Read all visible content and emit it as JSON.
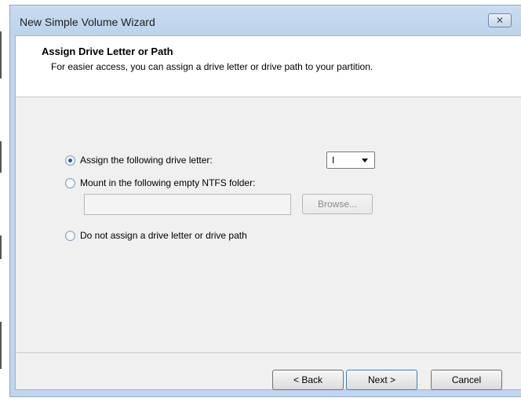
{
  "window": {
    "title": "New Simple Volume Wizard",
    "close_glyph": "✕"
  },
  "header": {
    "title": "Assign Drive Letter or Path",
    "subtitle": "For easier access, you can assign a drive letter or drive path to your partition."
  },
  "options": {
    "assign_letter": {
      "label": "Assign the following drive letter:",
      "checked": true
    },
    "mount_folder": {
      "label": "Mount in the following empty NTFS folder:",
      "checked": false
    },
    "no_assign": {
      "label": "Do not assign a drive letter or drive path",
      "checked": false
    }
  },
  "drive_letter": {
    "selected": "I"
  },
  "folder_path": {
    "value": ""
  },
  "buttons": {
    "browse": "Browse...",
    "back": "< Back",
    "next": "Next >",
    "cancel": "Cancel"
  },
  "icons": {
    "close": "close-icon",
    "dropdown": "chevron-down-icon"
  }
}
